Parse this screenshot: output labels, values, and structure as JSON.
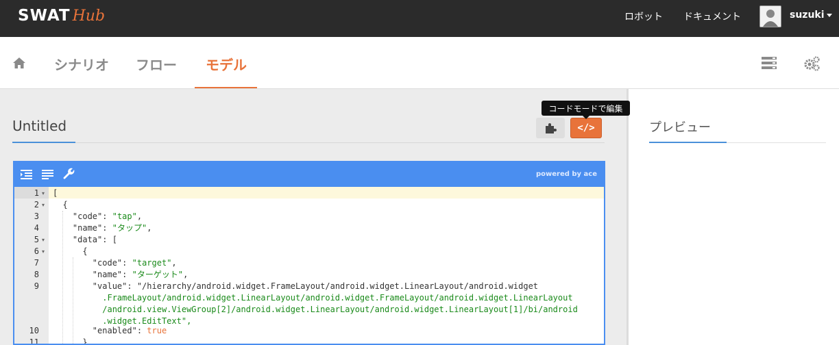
{
  "header": {
    "logo_main": "SWAT",
    "logo_accent": "Hub",
    "links": [
      "ロボット",
      "ドキュメント"
    ],
    "user_name": "suzuki"
  },
  "nav": {
    "tabs": [
      "シナリオ",
      "フロー",
      "モデル"
    ],
    "active_tab": "モデル"
  },
  "model": {
    "title": "Untitled",
    "tooltip": "コードモードで編集",
    "code_button_label": "</>"
  },
  "preview": {
    "title": "プレビュー"
  },
  "editor": {
    "powered_by": "powered by ace",
    "line_numbers": [
      "1",
      "2",
      "3",
      "4",
      "5",
      "6",
      "7",
      "8",
      "9",
      "",
      "",
      "",
      "10",
      "11"
    ],
    "lines": [
      "[",
      "  {",
      "    \"code\": \"tap\",",
      "    \"name\": \"タップ\",",
      "    \"data\": [",
      "      {",
      "        \"code\": \"target\",",
      "        \"name\": \"ターゲット\",",
      "        \"value\": \"/hierarchy/android.widget.FrameLayout/android.widget.LinearLayout/android.widget",
      "          .FrameLayout/android.widget.LinearLayout/android.widget.FrameLayout/android.widget.LinearLayout",
      "          /android.view.ViewGroup[2]/android.widget.LinearLayout/android.widget.LinearLayout[1]/bi/android",
      "          .widget.EditText\",",
      "        \"enabled\": true",
      "      }"
    ]
  },
  "colors": {
    "accent": "#e8733a",
    "editor_blue": "#4a8ef0",
    "string_green": "#1a8a1a"
  }
}
